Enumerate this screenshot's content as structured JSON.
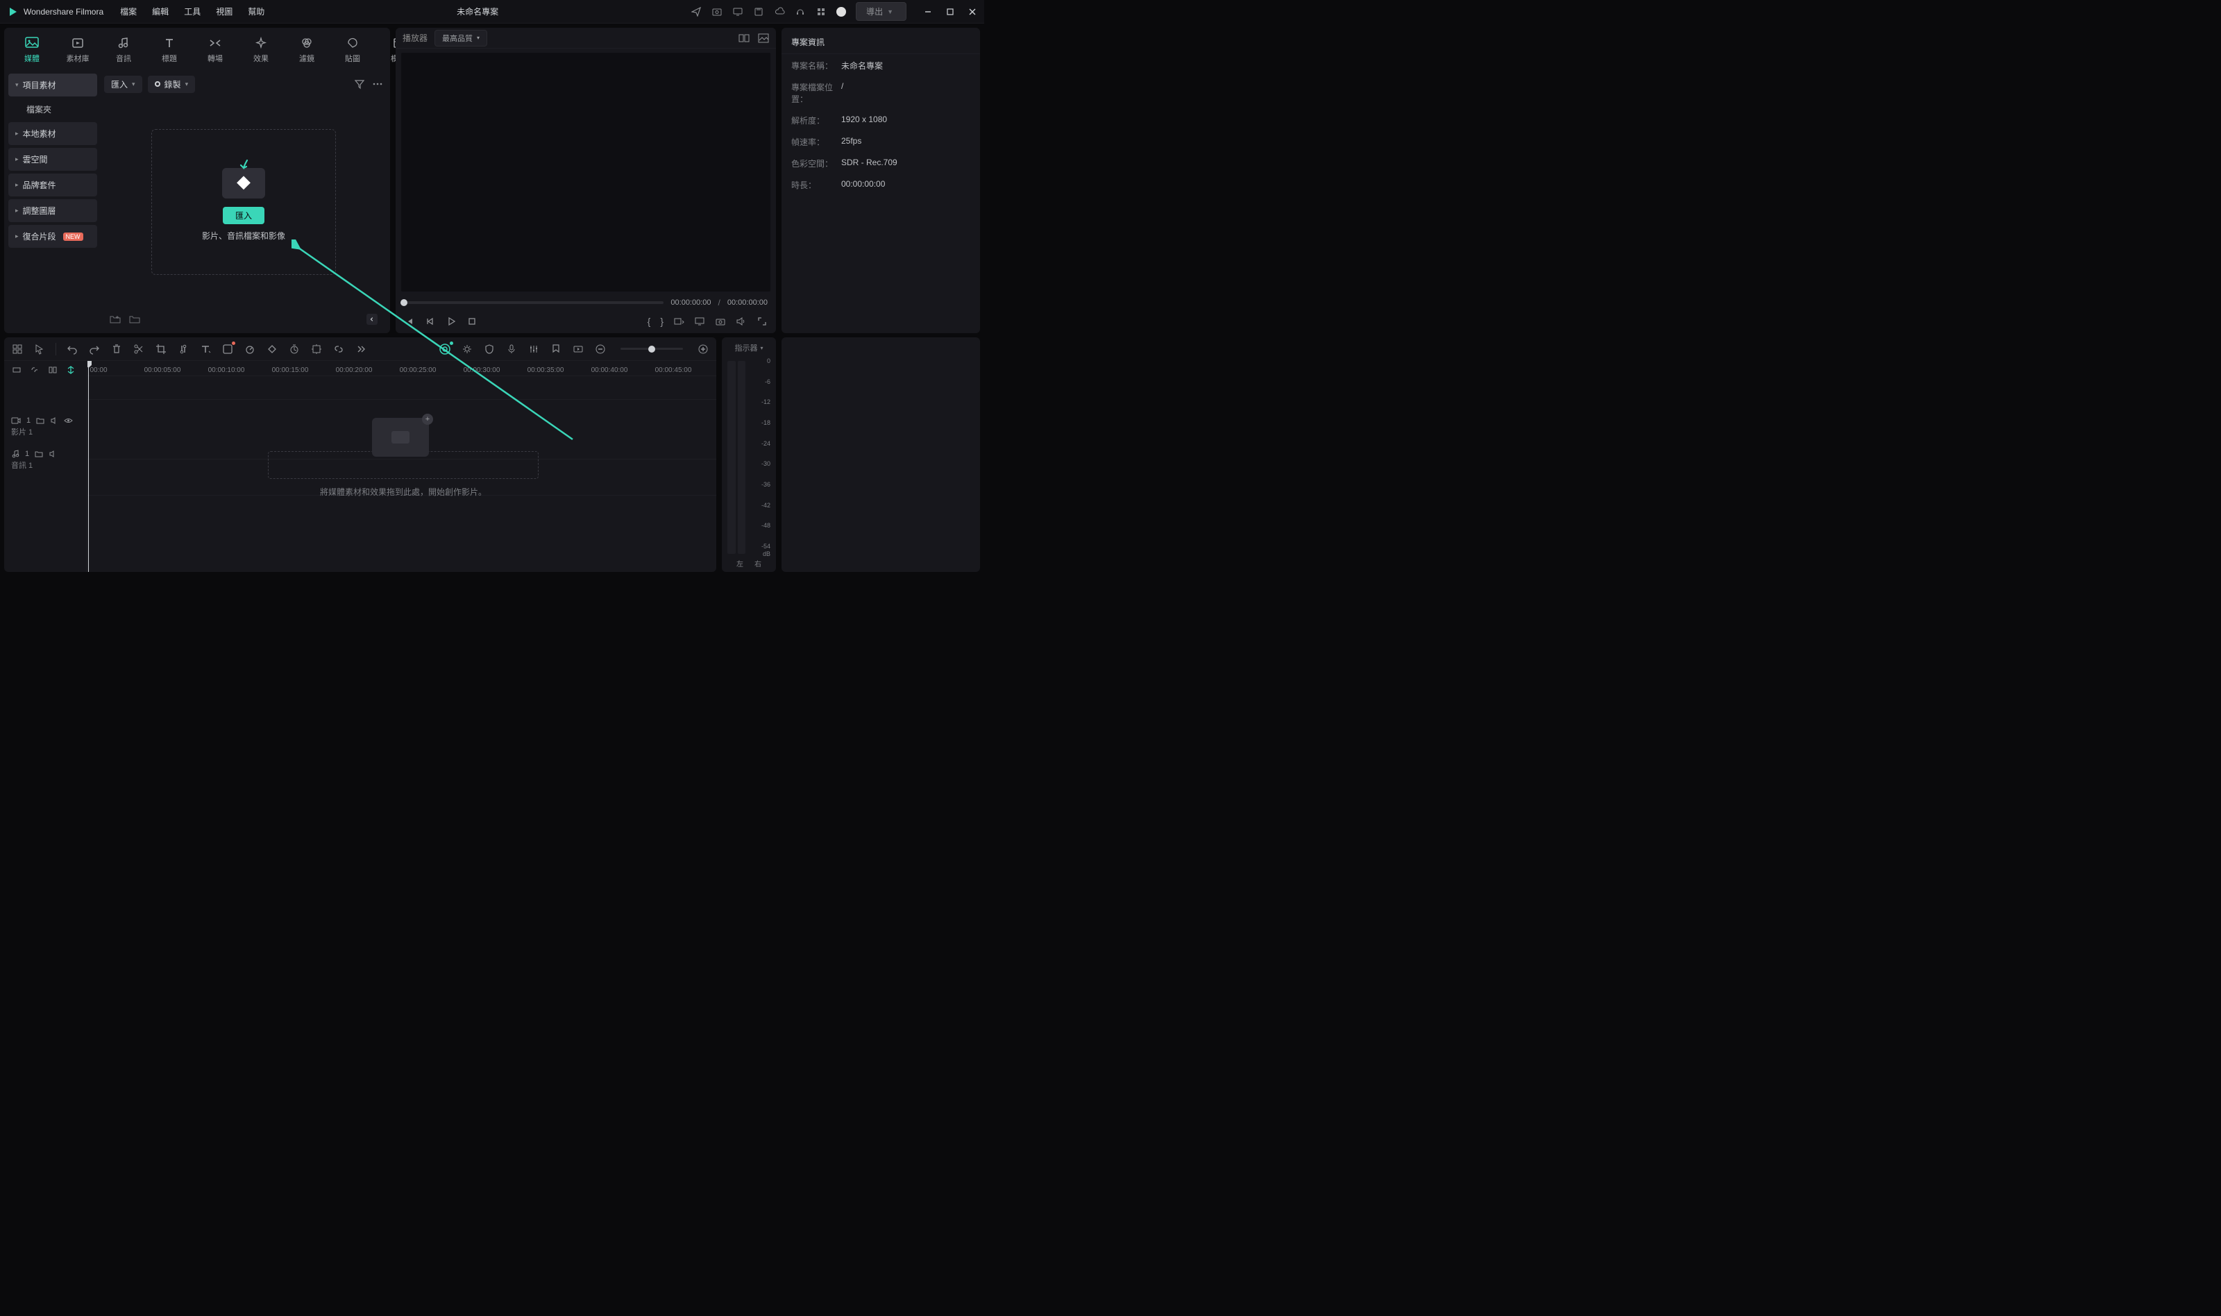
{
  "app": {
    "name": "Wondershare Filmora",
    "project_title": "未命名專案",
    "export": "導出"
  },
  "menu": [
    "檔案",
    "編輯",
    "工具",
    "視圖",
    "幫助"
  ],
  "top_tabs": [
    {
      "label": "媒體",
      "icon": "image-icon",
      "active": true
    },
    {
      "label": "素材庫",
      "icon": "stock-icon"
    },
    {
      "label": "音訊",
      "icon": "music-note-icon"
    },
    {
      "label": "標題",
      "icon": "text-icon"
    },
    {
      "label": "轉場",
      "icon": "transition-icon"
    },
    {
      "label": "效果",
      "icon": "sparkle-icon"
    },
    {
      "label": "濾鏡",
      "icon": "filter-icon"
    },
    {
      "label": "貼圖",
      "icon": "sticker-icon"
    },
    {
      "label": "模板",
      "icon": "template-icon"
    }
  ],
  "side_nav": {
    "items": [
      {
        "label": "項目素材",
        "active": true,
        "open": true,
        "children": [
          "檔案夾"
        ]
      },
      {
        "label": "本地素材"
      },
      {
        "label": "雲空間"
      },
      {
        "label": "品牌套件"
      },
      {
        "label": "調整圖層"
      },
      {
        "label": "復合片段",
        "badge": "NEW"
      }
    ]
  },
  "media_toolbar": {
    "import": "匯入",
    "record": "錄製"
  },
  "drop_zone": {
    "button": "匯入",
    "subtitle": "影片、音訊檔案和影像"
  },
  "player": {
    "label": "播放器",
    "quality": "最高品質",
    "time_current": "00:00:00:00",
    "time_total": "00:00:00:00"
  },
  "info": {
    "title": "專案資訊",
    "rows": [
      {
        "k": "專案名稱：",
        "v": "未命名專案"
      },
      {
        "k": "專案檔案位置：",
        "v": "/"
      },
      {
        "k": "解析度：",
        "v": "1920 x 1080"
      },
      {
        "k": "幀速率：",
        "v": "25fps"
      },
      {
        "k": "色彩空間：",
        "v": "SDR - Rec.709"
      },
      {
        "k": "時長：",
        "v": "00:00:00:00"
      }
    ]
  },
  "timeline": {
    "ruler": [
      "00:00",
      "00:00:05:00",
      "00:00:10:00",
      "00:00:15:00",
      "00:00:20:00",
      "00:00:25:00",
      "00:00:30:00",
      "00:00:35:00",
      "00:00:40:00",
      "00:00:45:00"
    ],
    "track_video": "影片 1",
    "track_audio": "音訊 1",
    "drop_hint": "將媒體素材和效果拖到此處，開始創作影片。"
  },
  "meter": {
    "title": "指示器",
    "labels": [
      "0",
      "-6",
      "-12",
      "-18",
      "-24",
      "-30",
      "-36",
      "-42",
      "-48",
      "-54"
    ],
    "unit": "dB",
    "left": "左",
    "right": "右"
  }
}
